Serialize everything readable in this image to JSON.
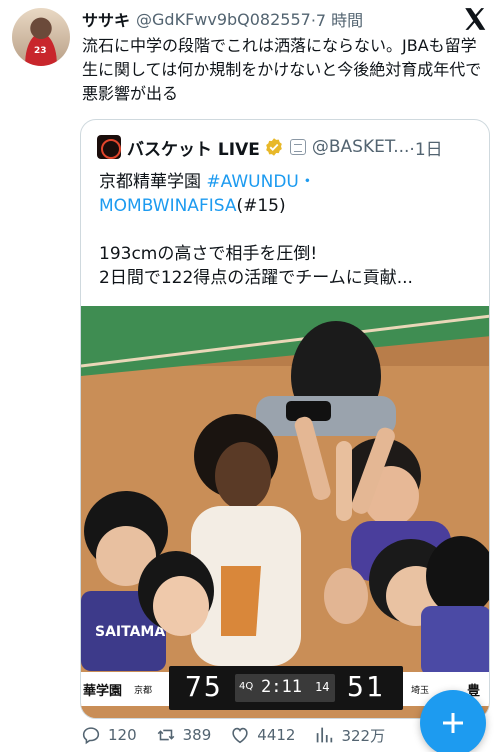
{
  "author": {
    "name": "ササキ",
    "handle": "@GdKFwv9bQ082557",
    "time": "·7 時間"
  },
  "tweet_text": "流石に中学の段階でこれは洒落にならない。JBAも留学生に関しては何か規制をかけないと今後絶対育成年代で悪影響が出る",
  "quote": {
    "name": "バスケット LIVE",
    "handle": "@BASKET...",
    "time": "·1日",
    "line1_plain": "京都精華学園 ",
    "line1_tag": "#AWUNDU・",
    "line2_tag": "MOMBWINAFISA",
    "line2_plain": "(#15)",
    "line3": "193cmの高さで相手を圧倒!",
    "line4": "2日間で122得点の活躍でチームに貢献..."
  },
  "scoreboard": {
    "left_team": "華学園",
    "left_label": "京都",
    "left_score": "75",
    "quarter": "4Q",
    "clock": "2:11",
    "shot_clock": "14",
    "right_score": "51",
    "right_label": "埼玉",
    "right_team": "豊",
    "jersey_text": "SAITAMA",
    "avatar_number": "23"
  },
  "stats": {
    "replies": "120",
    "reposts": "389",
    "likes": "4412",
    "views": "322万"
  },
  "colors": {
    "link": "#1d9bf0",
    "fab": "#1d9bf0",
    "text": "#0f1419",
    "muted": "#536471"
  }
}
